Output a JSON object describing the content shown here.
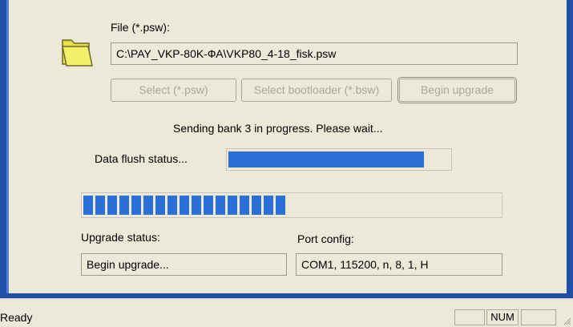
{
  "file": {
    "label": "File (*.psw):",
    "path": "C:\\PAY_VKP-80K-ФА\\VKP80_4-18_fisk.psw",
    "icon": "folder-icon"
  },
  "buttons": {
    "select_psw": "Select (*.psw)",
    "select_bootloader": "Select bootloader (*.bsw)",
    "begin_upgrade": "Begin upgrade"
  },
  "progress": {
    "message": "Sending bank 3 in progress. Please wait...",
    "flush_label": "Data flush status...",
    "flush_fraction": 0.885,
    "upgrade_fraction": 0.5
  },
  "upgrade_status": {
    "label": "Upgrade status:",
    "value": "Begin upgrade..."
  },
  "port_config": {
    "label": "Port config:",
    "value": "COM1, 115200, n, 8, 1, H"
  },
  "statusbar": {
    "text": "Ready",
    "num": "NUM"
  },
  "colors": {
    "window_frame": "#1f4fa8",
    "progress": "#2a6fd6",
    "background": "#ece9d8"
  }
}
